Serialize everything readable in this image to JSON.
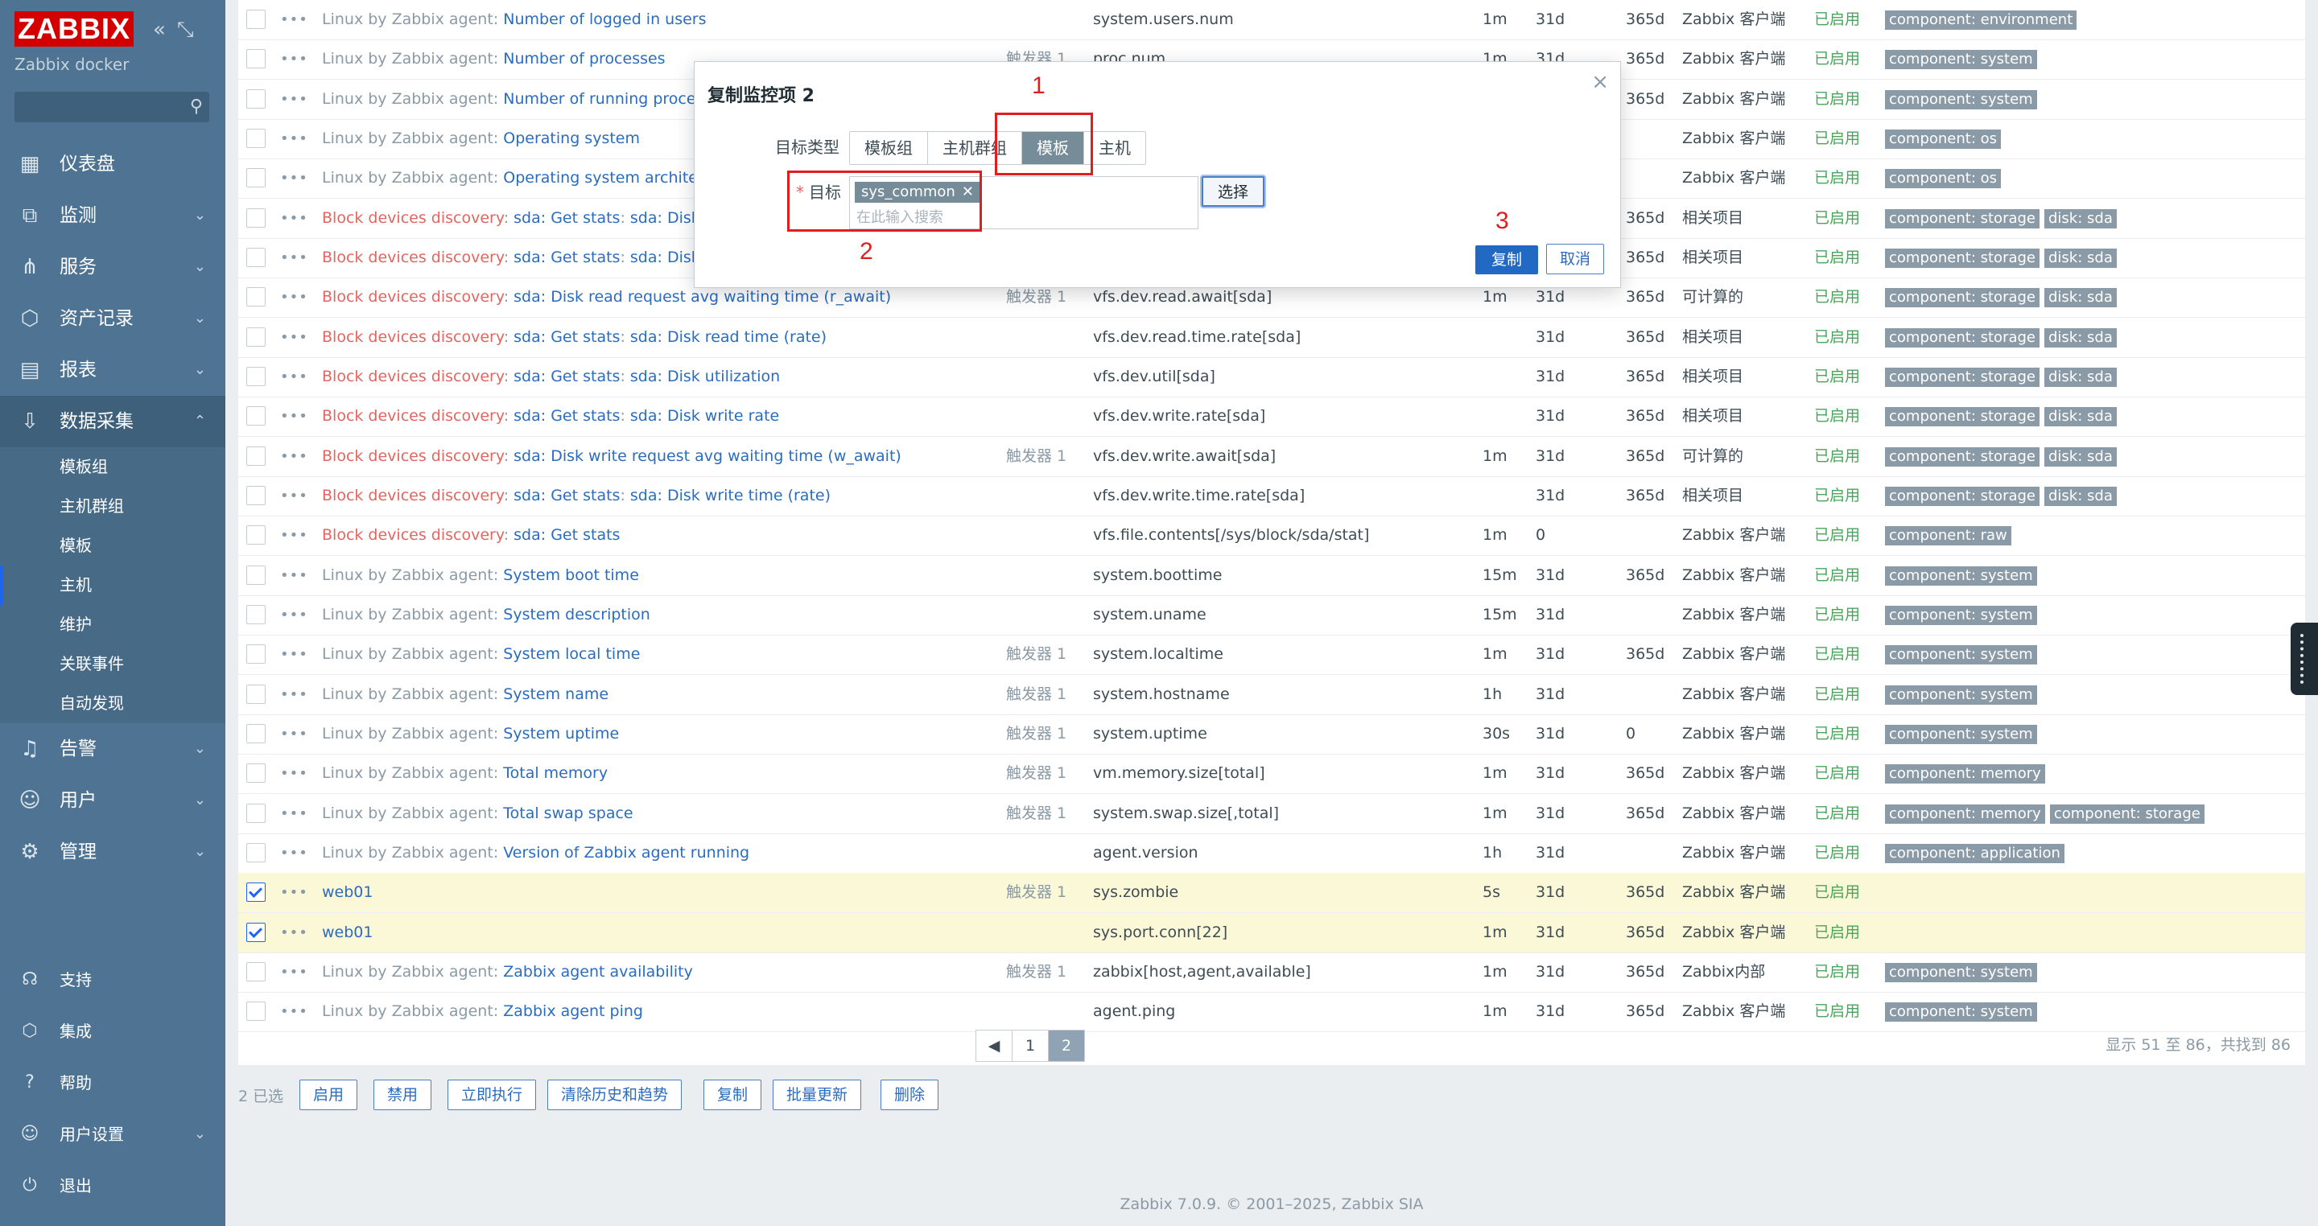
{
  "sidebar": {
    "logo": "ZABBIX",
    "server_name": "Zabbix docker",
    "menu": [
      {
        "label": "仪表盘",
        "icon": "dashboard-icon",
        "chevron": ""
      },
      {
        "label": "监测",
        "icon": "monitoring-icon",
        "chevron": "⌄"
      },
      {
        "label": "服务",
        "icon": "services-icon",
        "chevron": "⌄"
      },
      {
        "label": "资产记录",
        "icon": "inventory-icon",
        "chevron": "⌄"
      },
      {
        "label": "报表",
        "icon": "reports-icon",
        "chevron": "⌄"
      },
      {
        "label": "数据采集",
        "icon": "data-collection-icon",
        "chevron": "⌃"
      }
    ],
    "submenu": [
      "模板组",
      "主机群组",
      "模板",
      "主机",
      "维护",
      "关联事件",
      "自动发现"
    ],
    "menu2": [
      {
        "label": "告警",
        "icon": "alerts-icon",
        "chevron": "⌄"
      },
      {
        "label": "用户",
        "icon": "users-icon",
        "chevron": "⌄"
      },
      {
        "label": "管理",
        "icon": "administration-icon",
        "chevron": "⌄"
      }
    ],
    "bottom": [
      {
        "label": "支持",
        "icon": "support-icon",
        "chevron": ""
      },
      {
        "label": "集成",
        "icon": "integrations-icon",
        "chevron": ""
      },
      {
        "label": "帮助",
        "icon": "help-icon",
        "chevron": ""
      },
      {
        "label": "用户设置",
        "icon": "user-settings-icon",
        "chevron": "⌄"
      },
      {
        "label": "退出",
        "icon": "signout-icon",
        "chevron": ""
      }
    ]
  },
  "rows": [
    {
      "prefix": "Linux by Zabbix agent",
      "prefix_red": false,
      "sep": ": ",
      "mid": "",
      "name": "Number of logged in users",
      "trig": "",
      "key": "system.users.num",
      "interval": "1m",
      "history": "31d",
      "trends": "365d",
      "type": "Zabbix 客户端",
      "status": "已启用",
      "tags": [
        "component: environment"
      ],
      "selected": false
    },
    {
      "prefix": "Linux by Zabbix agent",
      "prefix_red": false,
      "sep": ": ",
      "mid": "",
      "name": "Number of processes",
      "trig": "触发器 1",
      "key": "proc.num",
      "interval": "1m",
      "history": "31d",
      "trends": "365d",
      "type": "Zabbix 客户端",
      "status": "已启用",
      "tags": [
        "component: system"
      ],
      "selected": false
    },
    {
      "prefix": "Linux by Zabbix agent",
      "prefix_red": false,
      "sep": ": ",
      "mid": "",
      "name": "Number of running processes",
      "trig": "",
      "key": "",
      "interval": "",
      "history": "",
      "trends": "365d",
      "type": "Zabbix 客户端",
      "status": "已启用",
      "tags": [
        "component: system"
      ],
      "selected": false
    },
    {
      "prefix": "Linux by Zabbix agent",
      "prefix_red": false,
      "sep": ": ",
      "mid": "",
      "name": "Operating system",
      "trig": "",
      "key": "",
      "interval": "",
      "history": "",
      "trends": "",
      "type": "Zabbix 客户端",
      "status": "已启用",
      "tags": [
        "component: os"
      ],
      "selected": false
    },
    {
      "prefix": "Linux by Zabbix agent",
      "prefix_red": false,
      "sep": ": ",
      "mid": "",
      "name": "Operating system architecture",
      "trig": "",
      "key": "",
      "interval": "",
      "history": "",
      "trends": "",
      "type": "Zabbix 客户端",
      "status": "已启用",
      "tags": [
        "component: os"
      ],
      "selected": false
    },
    {
      "prefix": "Block devices discovery",
      "prefix_red": true,
      "sep": ": ",
      "mid": "sda: Get stats",
      "name": "sda: Disk ave",
      "trig": "",
      "key": "",
      "interval": "",
      "history": "",
      "trends": "365d",
      "type": "相关项目",
      "status": "已启用",
      "tags": [
        "component: storage",
        "disk: sda"
      ],
      "selected": false
    },
    {
      "prefix": "Block devices discovery",
      "prefix_red": true,
      "sep": ": ",
      "mid": "sda: Get stats",
      "name": "sda: Disk read",
      "trig": "",
      "key": "",
      "interval": "",
      "history": "",
      "trends": "365d",
      "type": "相关项目",
      "status": "已启用",
      "tags": [
        "component: storage",
        "disk: sda"
      ],
      "selected": false
    },
    {
      "prefix": "Block devices discovery",
      "prefix_red": true,
      "sep": ": ",
      "mid": "",
      "name": "sda: Disk read request avg waiting time (r_await)",
      "trig": "触发器 1",
      "key": "vfs.dev.read.await[sda]",
      "interval": "1m",
      "history": "31d",
      "trends": "365d",
      "type": "可计算的",
      "status": "已启用",
      "tags": [
        "component: storage",
        "disk: sda"
      ],
      "selected": false
    },
    {
      "prefix": "Block devices discovery",
      "prefix_red": true,
      "sep": ": ",
      "mid": "sda: Get stats",
      "name": "sda: Disk read time (rate)",
      "trig": "",
      "key": "vfs.dev.read.time.rate[sda]",
      "interval": "",
      "history": "31d",
      "trends": "365d",
      "type": "相关项目",
      "status": "已启用",
      "tags": [
        "component: storage",
        "disk: sda"
      ],
      "selected": false
    },
    {
      "prefix": "Block devices discovery",
      "prefix_red": true,
      "sep": ": ",
      "mid": "sda: Get stats",
      "name": "sda: Disk utilization",
      "trig": "",
      "key": "vfs.dev.util[sda]",
      "interval": "",
      "history": "31d",
      "trends": "365d",
      "type": "相关项目",
      "status": "已启用",
      "tags": [
        "component: storage",
        "disk: sda"
      ],
      "selected": false
    },
    {
      "prefix": "Block devices discovery",
      "prefix_red": true,
      "sep": ": ",
      "mid": "sda: Get stats",
      "name": "sda: Disk write rate",
      "trig": "",
      "key": "vfs.dev.write.rate[sda]",
      "interval": "",
      "history": "31d",
      "trends": "365d",
      "type": "相关项目",
      "status": "已启用",
      "tags": [
        "component: storage",
        "disk: sda"
      ],
      "selected": false
    },
    {
      "prefix": "Block devices discovery",
      "prefix_red": true,
      "sep": ": ",
      "mid": "",
      "name": "sda: Disk write request avg waiting time (w_await)",
      "trig": "触发器 1",
      "key": "vfs.dev.write.await[sda]",
      "interval": "1m",
      "history": "31d",
      "trends": "365d",
      "type": "可计算的",
      "status": "已启用",
      "tags": [
        "component: storage",
        "disk: sda"
      ],
      "selected": false
    },
    {
      "prefix": "Block devices discovery",
      "prefix_red": true,
      "sep": ": ",
      "mid": "sda: Get stats",
      "name": "sda: Disk write time (rate)",
      "trig": "",
      "key": "vfs.dev.write.time.rate[sda]",
      "interval": "",
      "history": "31d",
      "trends": "365d",
      "type": "相关项目",
      "status": "已启用",
      "tags": [
        "component: storage",
        "disk: sda"
      ],
      "selected": false
    },
    {
      "prefix": "Block devices discovery",
      "prefix_red": true,
      "sep": ": ",
      "mid": "",
      "name": "sda: Get stats",
      "trig": "",
      "key": "vfs.file.contents[/sys/block/sda/stat]",
      "interval": "1m",
      "history": "0",
      "trends": "",
      "type": "Zabbix 客户端",
      "status": "已启用",
      "tags": [
        "component: raw"
      ],
      "selected": false
    },
    {
      "prefix": "Linux by Zabbix agent",
      "prefix_red": false,
      "sep": ": ",
      "mid": "",
      "name": "System boot time",
      "trig": "",
      "key": "system.boottime",
      "interval": "15m",
      "history": "31d",
      "trends": "365d",
      "type": "Zabbix 客户端",
      "status": "已启用",
      "tags": [
        "component: system"
      ],
      "selected": false
    },
    {
      "prefix": "Linux by Zabbix agent",
      "prefix_red": false,
      "sep": ": ",
      "mid": "",
      "name": "System description",
      "trig": "",
      "key": "system.uname",
      "interval": "15m",
      "history": "31d",
      "trends": "",
      "type": "Zabbix 客户端",
      "status": "已启用",
      "tags": [
        "component: system"
      ],
      "selected": false
    },
    {
      "prefix": "Linux by Zabbix agent",
      "prefix_red": false,
      "sep": ": ",
      "mid": "",
      "name": "System local time",
      "trig": "触发器 1",
      "key": "system.localtime",
      "interval": "1m",
      "history": "31d",
      "trends": "365d",
      "type": "Zabbix 客户端",
      "status": "已启用",
      "tags": [
        "component: system"
      ],
      "selected": false
    },
    {
      "prefix": "Linux by Zabbix agent",
      "prefix_red": false,
      "sep": ": ",
      "mid": "",
      "name": "System name",
      "trig": "触发器 1",
      "key": "system.hostname",
      "interval": "1h",
      "history": "31d",
      "trends": "",
      "type": "Zabbix 客户端",
      "status": "已启用",
      "tags": [
        "component: system"
      ],
      "selected": false
    },
    {
      "prefix": "Linux by Zabbix agent",
      "prefix_red": false,
      "sep": ": ",
      "mid": "",
      "name": "System uptime",
      "trig": "触发器 1",
      "key": "system.uptime",
      "interval": "30s",
      "history": "31d",
      "trends": "0",
      "type": "Zabbix 客户端",
      "status": "已启用",
      "tags": [
        "component: system"
      ],
      "selected": false
    },
    {
      "prefix": "Linux by Zabbix agent",
      "prefix_red": false,
      "sep": ": ",
      "mid": "",
      "name": "Total memory",
      "trig": "触发器 1",
      "key": "vm.memory.size[total]",
      "interval": "1m",
      "history": "31d",
      "trends": "365d",
      "type": "Zabbix 客户端",
      "status": "已启用",
      "tags": [
        "component: memory"
      ],
      "selected": false
    },
    {
      "prefix": "Linux by Zabbix agent",
      "prefix_red": false,
      "sep": ": ",
      "mid": "",
      "name": "Total swap space",
      "trig": "触发器 1",
      "key": "system.swap.size[,total]",
      "interval": "1m",
      "history": "31d",
      "trends": "365d",
      "type": "Zabbix 客户端",
      "status": "已启用",
      "tags": [
        "component: memory",
        "component: storage"
      ],
      "selected": false
    },
    {
      "prefix": "Linux by Zabbix agent",
      "prefix_red": false,
      "sep": ": ",
      "mid": "",
      "name": "Version of Zabbix agent running",
      "trig": "",
      "key": "agent.version",
      "interval": "1h",
      "history": "31d",
      "trends": "",
      "type": "Zabbix 客户端",
      "status": "已启用",
      "tags": [
        "component: application"
      ],
      "selected": false
    },
    {
      "prefix": "",
      "prefix_red": false,
      "sep": "",
      "mid": "",
      "name": "web01",
      "trig": "触发器 1",
      "key": "sys.zombie",
      "interval": "5s",
      "history": "31d",
      "trends": "365d",
      "type": "Zabbix 客户端",
      "status": "已启用",
      "tags": [],
      "selected": true
    },
    {
      "prefix": "",
      "prefix_red": false,
      "sep": "",
      "mid": "",
      "name": "web01",
      "trig": "",
      "key": "sys.port.conn[22]",
      "interval": "1m",
      "history": "31d",
      "trends": "365d",
      "type": "Zabbix 客户端",
      "status": "已启用",
      "tags": [],
      "selected": true
    },
    {
      "prefix": "Linux by Zabbix agent",
      "prefix_red": false,
      "sep": ": ",
      "mid": "",
      "name": "Zabbix agent availability",
      "trig": "触发器 1",
      "key": "zabbix[host,agent,available]",
      "interval": "1m",
      "history": "31d",
      "trends": "365d",
      "type": "Zabbix内部",
      "status": "已启用",
      "tags": [
        "component: system"
      ],
      "selected": false
    },
    {
      "prefix": "Linux by Zabbix agent",
      "prefix_red": false,
      "sep": ": ",
      "mid": "",
      "name": "Zabbix agent ping",
      "trig": "",
      "key": "agent.ping",
      "interval": "1m",
      "history": "31d",
      "trends": "365d",
      "type": "Zabbix 客户端",
      "status": "已启用",
      "tags": [
        "component: system"
      ],
      "selected": false
    }
  ],
  "pager": {
    "prev": "◀",
    "pages": [
      "1",
      "2"
    ],
    "current": "2",
    "shown": "显示 51 至 86，共找到 86"
  },
  "actions": {
    "selected": "2 已选",
    "buttons": [
      "启用",
      "禁用",
      "立即执行",
      "清除历史和趋势",
      "复制",
      "批量更新",
      "删除"
    ]
  },
  "footer": "Zabbix 7.0.9. © 2001–2025, Zabbix SIA",
  "dialog": {
    "title": "复制监控项 2",
    "close": "×",
    "target_type_label": "目标类型",
    "target_types": [
      "模板组",
      "主机群组",
      "模板",
      "主机"
    ],
    "target_type_selected": "模板",
    "target_label": "目标",
    "required_mark": "*",
    "chip": "sys_common",
    "chip_remove": "✕",
    "placeholder": "在此输入搜索",
    "select_btn": "选择",
    "copy_btn": "复制",
    "cancel_btn": "取消"
  },
  "annotations": [
    "1",
    "2",
    "3"
  ]
}
